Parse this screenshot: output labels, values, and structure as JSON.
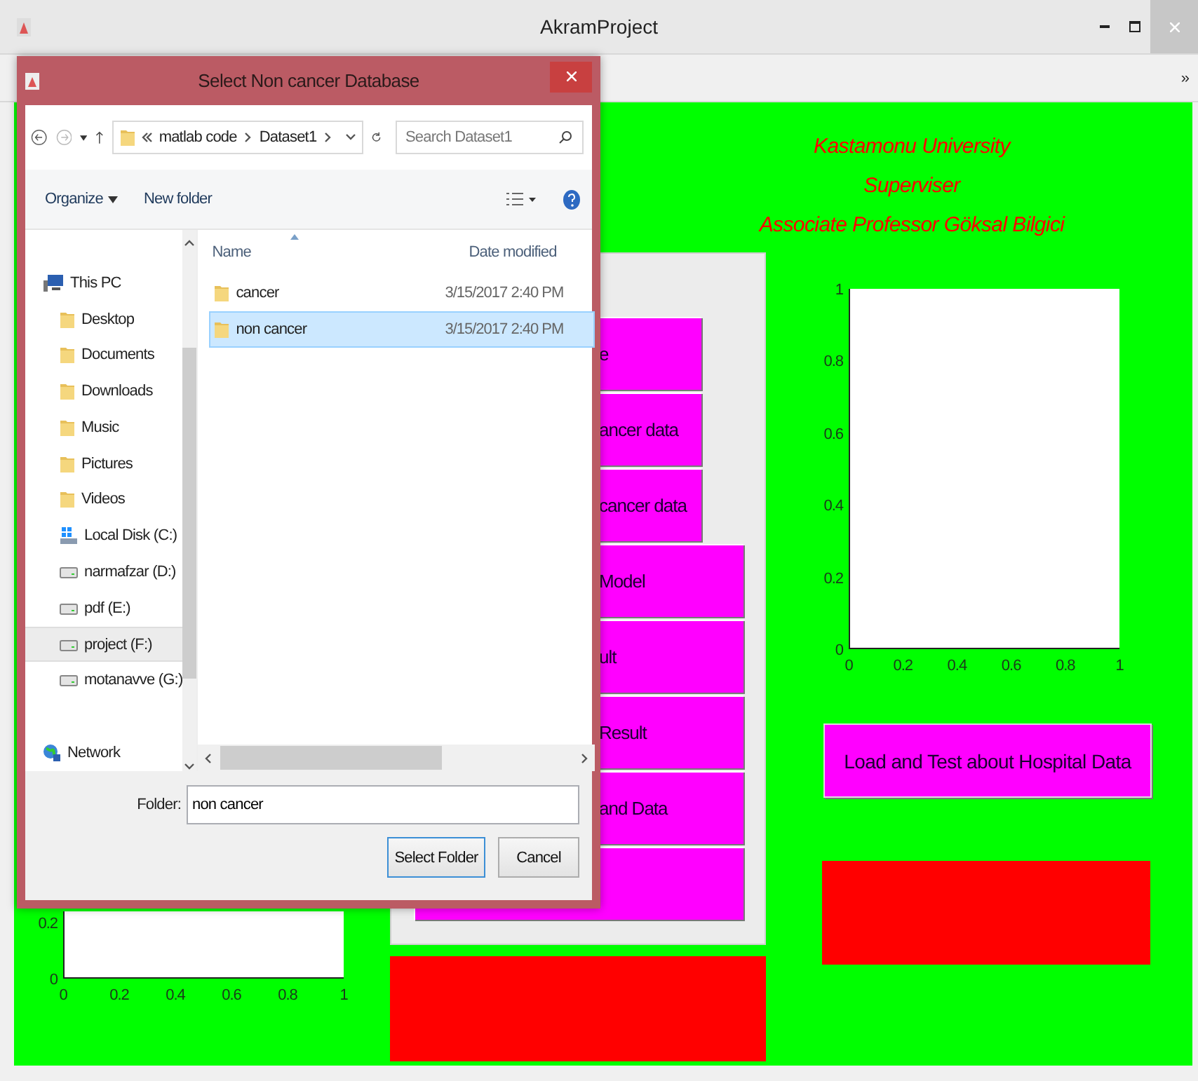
{
  "window": {
    "title": "AkramProject"
  },
  "toolbar": {
    "overflow": "»"
  },
  "figure": {
    "heading": [
      "Kastamonu University",
      "Superviser",
      "Associate Professor Göksal Bilgici"
    ],
    "left_axes": {
      "yticks": [
        "0.2",
        "0"
      ],
      "xticks": [
        "0",
        "0.2",
        "0.4",
        "0.6",
        "0.8",
        "1"
      ]
    },
    "panel_buttons": [
      {
        "label": "e",
        "kind": "short"
      },
      {
        "label": "ancer data",
        "kind": "short"
      },
      {
        "label": "cancer data",
        "kind": "short"
      },
      {
        "label": "Model",
        "kind": "long"
      },
      {
        "label": "ult",
        "kind": "long"
      },
      {
        "label": "Result",
        "kind": "long"
      },
      {
        "label": "and Data",
        "kind": "long"
      },
      {
        "kind": "long"
      }
    ],
    "right_axes": {
      "yticks": [
        "1",
        "0.8",
        "0.6",
        "0.4",
        "0.2",
        "0"
      ],
      "xticks": [
        "0",
        "0.2",
        "0.4",
        "0.6",
        "0.8",
        "1"
      ]
    },
    "hospital_button": "Load and Test about Hospital Data"
  },
  "dialog": {
    "title": "Select Non cancer Database",
    "path": [
      "matlab code",
      "Dataset1"
    ],
    "search_placeholder": "Search Dataset1",
    "commands": [
      "Organize",
      "New folder"
    ],
    "nav": [
      {
        "label": "This PC",
        "kind": "pc",
        "selected": false,
        "children": [
          {
            "label": "Desktop",
            "kind": "folder",
            "selected": false
          },
          {
            "label": "Documents",
            "kind": "folder",
            "selected": false
          },
          {
            "label": "Downloads",
            "kind": "folder",
            "selected": false
          },
          {
            "label": "Music",
            "kind": "folder",
            "selected": false
          },
          {
            "label": "Pictures",
            "kind": "folder",
            "selected": false
          },
          {
            "label": "Videos",
            "kind": "folder",
            "selected": false
          },
          {
            "label": "Local Disk (C:)",
            "kind": "system-disk",
            "selected": false
          },
          {
            "label": "narmafzar (D:)",
            "kind": "drive",
            "selected": false
          },
          {
            "label": "pdf (E:)",
            "kind": "drive",
            "selected": false
          },
          {
            "label": "project (F:)",
            "kind": "drive",
            "selected": true
          },
          {
            "label": "motanavve (G:)",
            "kind": "drive",
            "selected": false
          }
        ]
      },
      {
        "label": "Network",
        "kind": "network",
        "selected": false
      }
    ],
    "columns": [
      "Name",
      "Date modified"
    ],
    "files": [
      {
        "name": "cancer",
        "date": "3/15/2017 2:40 PM",
        "selected": false
      },
      {
        "name": "non cancer",
        "date": "3/15/2017 2:40 PM",
        "selected": true
      }
    ],
    "folder_label": "Folder:",
    "folder_value": "non cancer",
    "buttons": [
      "Select Folder",
      "Cancel"
    ]
  }
}
